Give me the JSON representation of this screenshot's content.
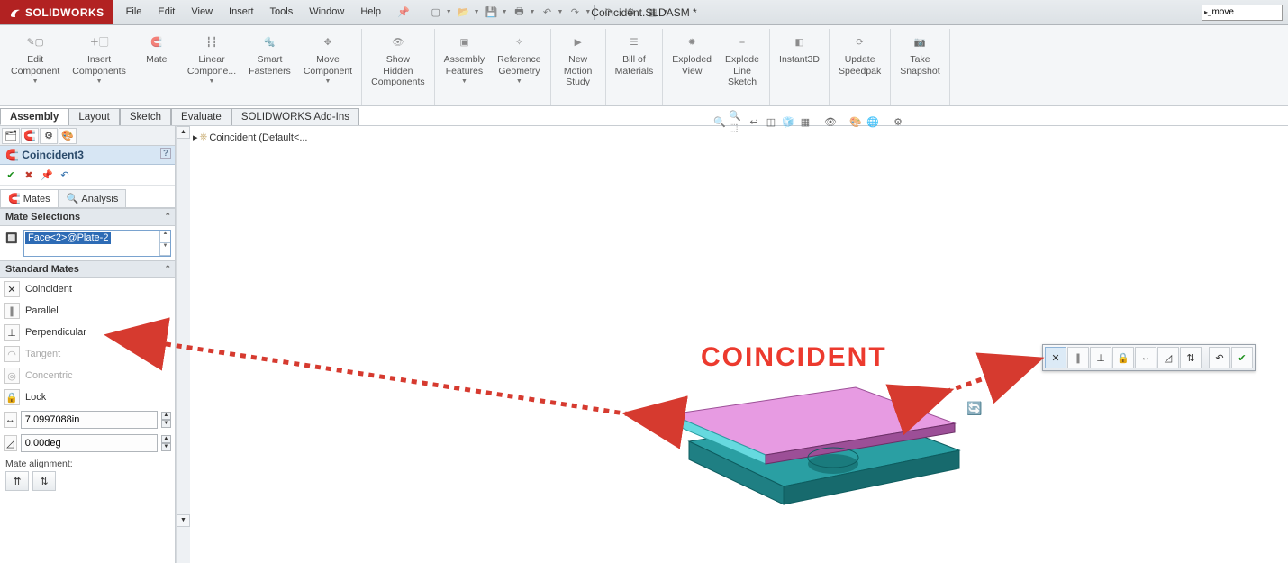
{
  "app": {
    "name": "SOLIDWORKS",
    "doc_title": "Coincident.SLDASM *",
    "search_value": "move"
  },
  "menus": [
    "File",
    "Edit",
    "View",
    "Insert",
    "Tools",
    "Window",
    "Help"
  ],
  "ribbon": [
    {
      "label": "Edit\nComponent",
      "drop": true
    },
    {
      "label": "Insert\nComponents",
      "drop": true
    },
    {
      "label": "Mate"
    },
    {
      "label": "Linear\nCompone...",
      "drop": true
    },
    {
      "label": "Smart\nFasteners"
    },
    {
      "label": "Move\nComponent",
      "drop": true
    },
    {
      "label": "Show\nHidden\nComponents"
    },
    {
      "label": "Assembly\nFeatures",
      "drop": true
    },
    {
      "label": "Reference\nGeometry",
      "drop": true
    },
    {
      "label": "New\nMotion\nStudy"
    },
    {
      "label": "Bill of\nMaterials"
    },
    {
      "label": "Exploded\nView"
    },
    {
      "label": "Explode\nLine\nSketch"
    },
    {
      "label": "Instant3D"
    },
    {
      "label": "Update\nSpeedpak"
    },
    {
      "label": "Take\nSnapshot"
    }
  ],
  "tabs": {
    "items": [
      "Assembly",
      "Layout",
      "Sketch",
      "Evaluate",
      "SOLIDWORKS Add-Ins"
    ],
    "active": 0
  },
  "pm": {
    "title": "Coincident3",
    "subtabs": {
      "mates": "Mates",
      "analysis": "Analysis"
    },
    "section_selections": "Mate Selections",
    "selection_item": "Face<2>@Plate-2",
    "section_standard": "Standard Mates",
    "mates": [
      {
        "name": "Coincident",
        "glyph": "coincident"
      },
      {
        "name": "Parallel",
        "glyph": "parallel"
      },
      {
        "name": "Perpendicular",
        "glyph": "perpendicular"
      },
      {
        "name": "Tangent",
        "glyph": "tangent",
        "disabled": true
      },
      {
        "name": "Concentric",
        "glyph": "concentric",
        "disabled": true
      },
      {
        "name": "Lock",
        "glyph": "lock"
      }
    ],
    "distance_value": "7.0997088in",
    "angle_value": "0.00deg",
    "alignment_label": "Mate alignment:"
  },
  "tree": {
    "root": "Coincident  (Default<..."
  },
  "annotation": {
    "big_label": "COINCIDENT"
  }
}
